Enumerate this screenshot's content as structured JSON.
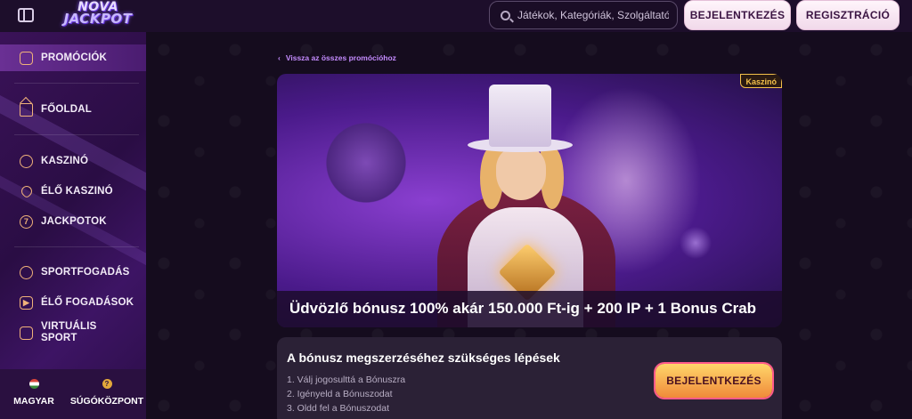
{
  "header": {
    "logo_line1": "NOVA",
    "logo_line2": "JACKPOT",
    "search_placeholder": "Játékok, Kategóriák, Szolgáltatók",
    "login_label": "BEJELENTKEZÉS",
    "register_label": "REGISZTRÁCIÓ"
  },
  "sidebar": {
    "items": [
      {
        "label": "PROMÓCIÓK",
        "icon": "gift-icon"
      },
      {
        "label": "FŐOLDAL",
        "icon": "home-icon"
      },
      {
        "label": "KASZINÓ",
        "icon": "chip-icon"
      },
      {
        "label": "ÉLŐ KASZINÓ",
        "icon": "clover-icon"
      },
      {
        "label": "JACKPOTOK",
        "icon": "seven-icon"
      },
      {
        "label": "SPORTFOGADÁS",
        "icon": "ball-icon"
      },
      {
        "label": "ÉLŐ FOGADÁSOK",
        "icon": "live-icon"
      },
      {
        "label": "VIRTUÁLIS SPORT",
        "icon": "gamepad-icon"
      }
    ],
    "language_label": "MAGYAR",
    "help_label": "SÚGÓKÖZPONT"
  },
  "main": {
    "back_link": "Vissza az összes promócióhoz",
    "banner_badge": "Kaszinó",
    "banner_title": "Üdvözlő bónusz 100% akár 150.000 Ft-ig + 200 IP + 1 Bonus Crab",
    "steps_title": "A bónusz megszerzéséhez szükséges lépések",
    "steps": [
      "1. Válj jogosulttá a Bónuszra",
      "2. Igényeld a Bónuszodat",
      "3. Oldd fel a Bónuszodat"
    ],
    "cta_label": "BEJELENTKEZÉS"
  }
}
